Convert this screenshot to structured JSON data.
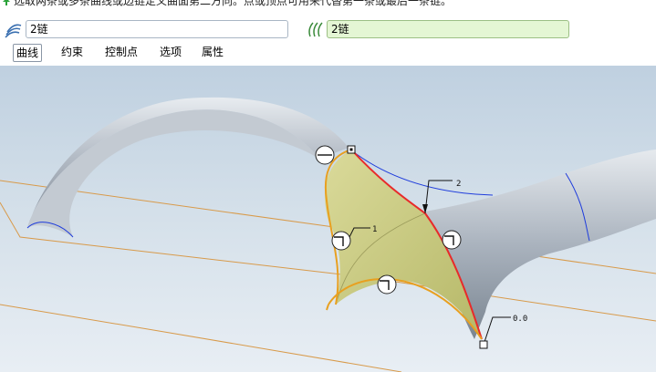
{
  "prompt": {
    "text": "选取两条或多条曲线或边链定义曲面第二方向。点或顶点可用来代替第一条或最后一条链。"
  },
  "collectors": {
    "first_direction": {
      "value": "2链"
    },
    "second_direction": {
      "value": "2链"
    }
  },
  "tabs": [
    {
      "label": "曲线",
      "active": true
    },
    {
      "label": "约束",
      "active": false
    },
    {
      "label": "控制点",
      "active": false
    },
    {
      "label": "选项",
      "active": false
    },
    {
      "label": "属性",
      "active": false
    }
  ],
  "graphics": {
    "labels": {
      "dim_2": "2",
      "dim_1": "1",
      "dim_0": "0.0"
    }
  },
  "colors": {
    "accent_orange": "#e8a020",
    "curve_red": "#e82a2a",
    "surface_yellow": "#d8d888",
    "datum_orange": "#d89a4a",
    "field_green": "#e4f6d4",
    "blue_edge": "#1e3cdc"
  }
}
